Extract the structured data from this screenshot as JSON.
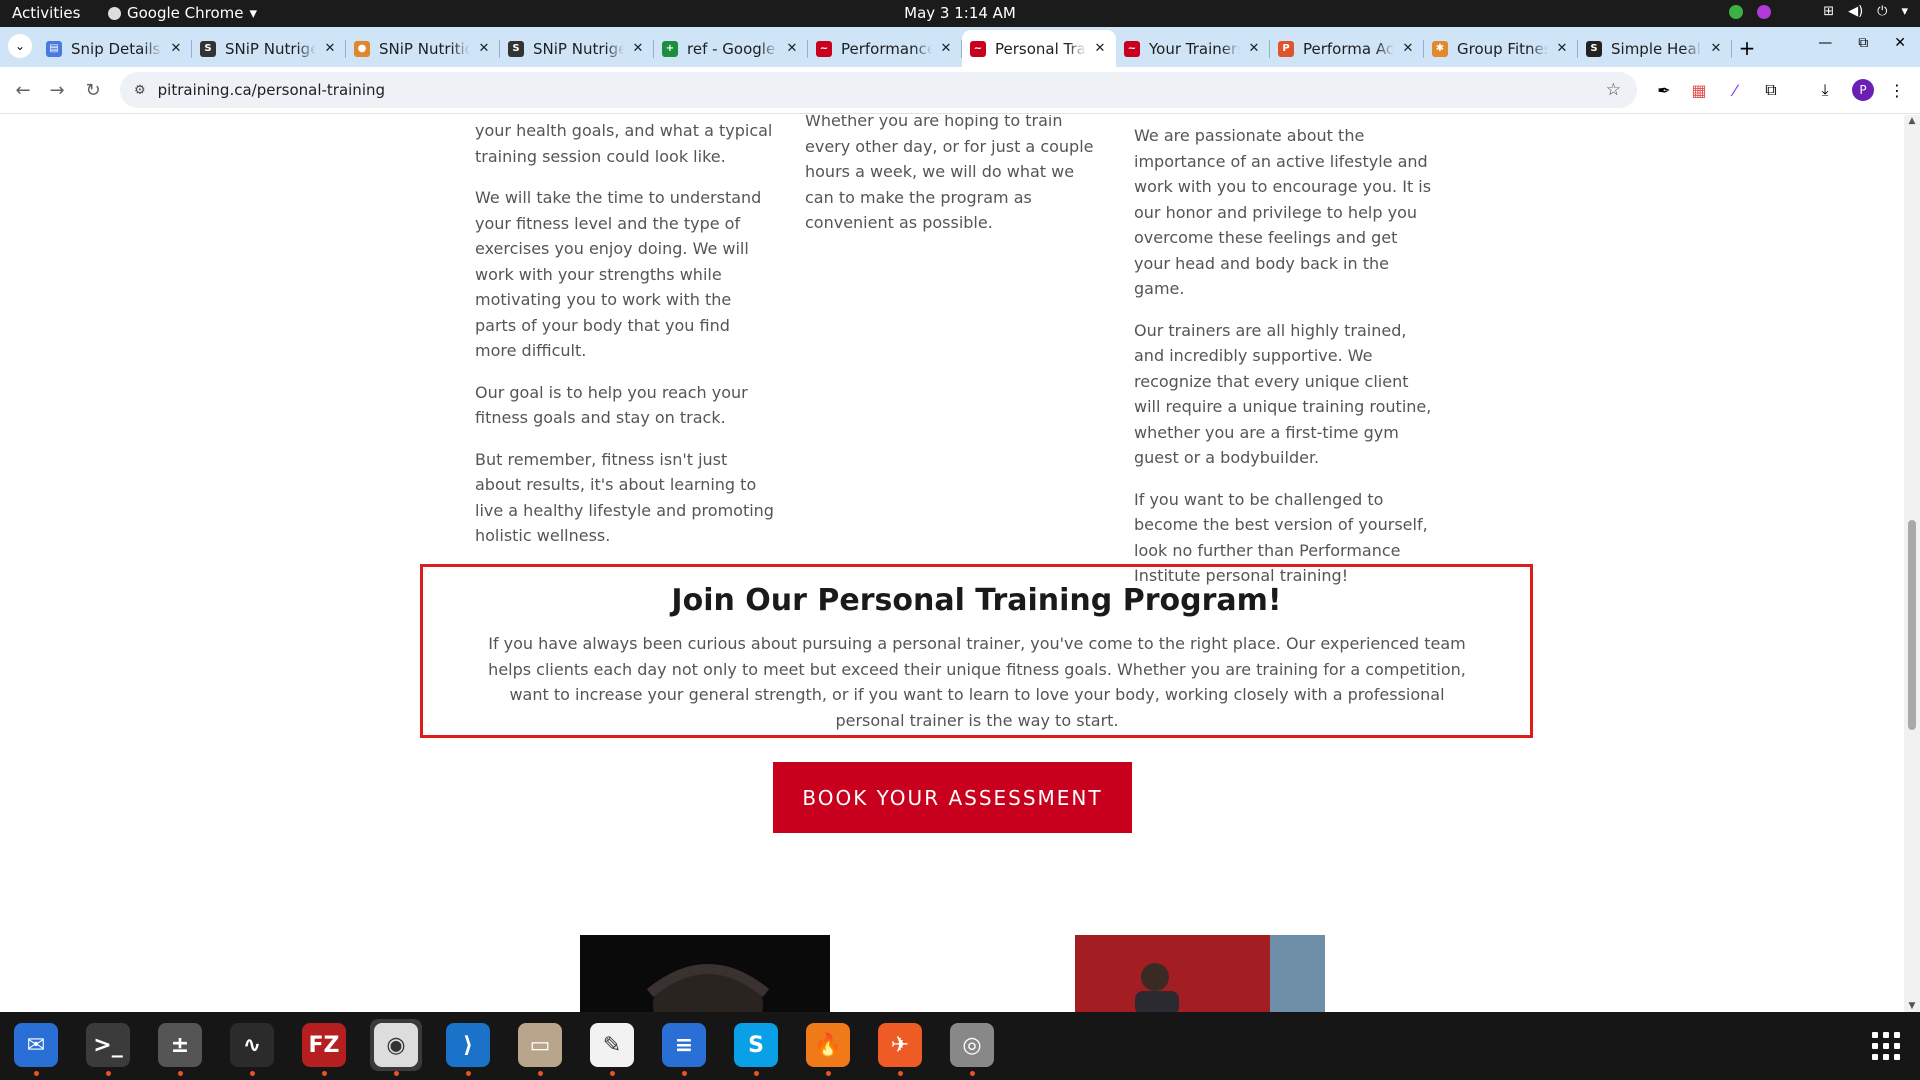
{
  "system": {
    "activities": "Activities",
    "app_name": "Google Chrome",
    "clock": "May 3  1:14 AM"
  },
  "browser": {
    "tabs": [
      {
        "title": "Snip Details",
        "color": "#4a7ae0",
        "glyph": "▤"
      },
      {
        "title": "SNiP Nutrigenomics",
        "color": "#333333",
        "glyph": "S"
      },
      {
        "title": "SNiP Nutrition",
        "color": "#e0862b",
        "glyph": "●"
      },
      {
        "title": "SNiP Nutrigenomics",
        "color": "#333333",
        "glyph": "S"
      },
      {
        "title": "ref - Google Sheets",
        "color": "#1e8e3e",
        "glyph": "+"
      },
      {
        "title": "Performance Institute",
        "color": "#c8001e",
        "glyph": "~"
      },
      {
        "title": "Personal Training",
        "color": "#c8001e",
        "glyph": "~",
        "active": true
      },
      {
        "title": "Your Trainers",
        "color": "#c8001e",
        "glyph": "~"
      },
      {
        "title": "Performa Academy",
        "color": "#e0542b",
        "glyph": "P"
      },
      {
        "title": "Group Fitness",
        "color": "#e08a2b",
        "glyph": "✱"
      },
      {
        "title": "Simple Health",
        "color": "#222222",
        "glyph": "S"
      }
    ],
    "url": "pitraining.ca/personal-training"
  },
  "page": {
    "col1": [
      "your health goals, and what a typical training session could look like.",
      "We will take the time to understand your fitness level and the type of exercises you enjoy doing. We will work with your strengths while motivating you to work with the parts of your body that you find more difficult.",
      "Our goal is to help you reach your fitness goals and stay on track.",
      "But remember, fitness isn't just about results, it's about learning to live a healthy lifestyle and promoting holistic wellness."
    ],
    "col2": [
      "Whether you are hoping to train every other day, or for just a couple hours a week, we will do what we can to make the program as convenient as possible."
    ],
    "col3": [
      "We are passionate about the importance of an active lifestyle and work with you to encourage you. It is our honor and privilege to help you overcome these feelings and get your head and body back in the game.",
      "Our trainers are all highly trained, and incredibly supportive. We recognize that every unique client will require a unique training routine, whether you are a first-time gym guest or a bodybuilder.",
      "If you want to be challenged to become the best version of yourself, look no further than Performance Institute personal training!"
    ],
    "join_title": "Join Our Personal Training Program!",
    "join_body": "If you have always been curious about pursuing a personal trainer, you've come to the right place. Our experienced team helps clients each day not only to meet but exceed their unique fitness goals. Whether you are training for a competition, want to increase your general strength, or if you want to learn to love your body, working closely with a professional personal trainer is the way to start.",
    "cta": "BOOK YOUR ASSESSMENT"
  },
  "dock": [
    {
      "name": "thunderbird",
      "color": "#2a6fd6",
      "glyph": "✉"
    },
    {
      "name": "terminal",
      "color": "#3b3b3b",
      "glyph": ">_"
    },
    {
      "name": "calculator",
      "color": "#555555",
      "glyph": "±"
    },
    {
      "name": "system-monitor",
      "color": "#2b2b2b",
      "glyph": "∿"
    },
    {
      "name": "filezilla",
      "color": "#b51f1f",
      "glyph": "FZ"
    },
    {
      "name": "google-chrome",
      "color": "#dddddd",
      "glyph": "◉",
      "active": true
    },
    {
      "name": "vscode",
      "color": "#1a73c8",
      "glyph": "⟩"
    },
    {
      "name": "files",
      "color": "#b9a58c",
      "glyph": "▭"
    },
    {
      "name": "text-editor",
      "color": "#f2f2f2",
      "glyph": "✎"
    },
    {
      "name": "libreoffice-writer",
      "color": "#2a6fd6",
      "glyph": "≡"
    },
    {
      "name": "skype",
      "color": "#0aa0e8",
      "glyph": "S"
    },
    {
      "name": "firefox-dev",
      "color": "#f07a1a",
      "glyph": "🔥"
    },
    {
      "name": "postman",
      "color": "#ef5b25",
      "glyph": "✈"
    },
    {
      "name": "disks",
      "color": "#888888",
      "glyph": "◎"
    }
  ]
}
